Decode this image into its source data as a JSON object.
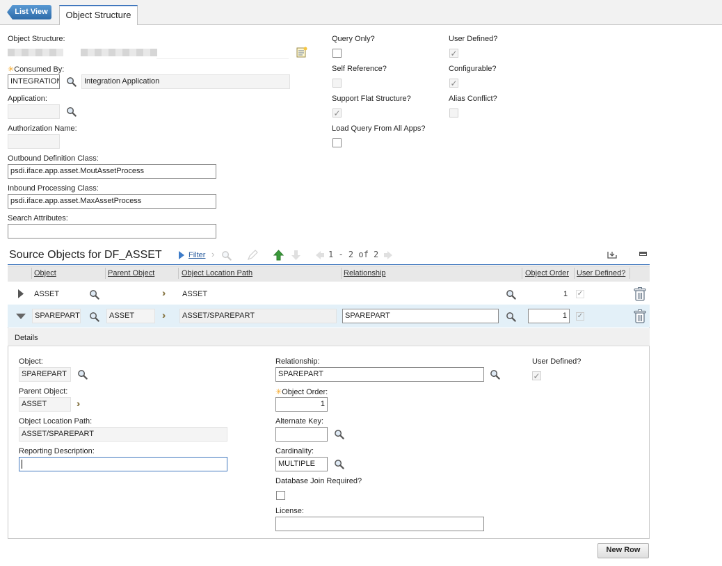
{
  "nav": {
    "list_view": "List View",
    "tab": "Object Structure"
  },
  "form": {
    "object_structure_label": "Object Structure:",
    "consumed_by_label": "Consumed By:",
    "consumed_by_value": "INTEGRATION",
    "consumed_by_desc": "Integration Application",
    "application_label": "Application:",
    "auth_name_label": "Authorization Name:",
    "outbound_label": "Outbound Definition Class:",
    "outbound_value": "psdi.iface.app.asset.MoutAssetProcess",
    "inbound_label": "Inbound Processing Class:",
    "inbound_value": "psdi.iface.app.asset.MaxAssetProcess",
    "search_attr_label": "Search Attributes:",
    "query_only_label": "Query Only?",
    "self_ref_label": "Self Reference?",
    "flat_label": "Support Flat Structure?",
    "load_query_label": "Load Query From All Apps?",
    "user_defined_label": "User Defined?",
    "configurable_label": "Configurable?",
    "alias_label": "Alias Conflict?"
  },
  "table": {
    "title": "Source Objects for DF_ASSET",
    "filter": "Filter",
    "pagination": "1 - 2 of 2",
    "columns": [
      "Object",
      "Parent Object",
      "Object Location Path",
      "Relationship",
      "Object Order",
      "User Defined?"
    ],
    "rows": [
      {
        "object": "ASSET",
        "parent": "",
        "path": "ASSET",
        "relationship": "",
        "order": "1"
      },
      {
        "object": "SPAREPART",
        "parent": "ASSET",
        "path": "ASSET/SPAREPART",
        "relationship": "SPAREPART",
        "order": "1"
      }
    ]
  },
  "details": {
    "title": "Details",
    "object_label": "Object:",
    "object_value": "SPAREPART",
    "parent_label": "Parent Object:",
    "parent_value": "ASSET",
    "path_label": "Object Location Path:",
    "path_value": "ASSET/SPAREPART",
    "reporting_label": "Reporting Description:",
    "relationship_label": "Relationship:",
    "relationship_value": "SPAREPART",
    "order_label": "Object Order:",
    "order_value": "1",
    "alt_key_label": "Alternate Key:",
    "cardinality_label": "Cardinality:",
    "cardinality_value": "MULTIPLE",
    "db_join_label": "Database Join Required?",
    "license_label": "License:",
    "user_defined_label": "User Defined?"
  },
  "new_row": "New Row",
  "colors": {
    "accent": "#4178be",
    "selected_row": "#e3f0f8",
    "green_arrow": "#3a9a3a"
  }
}
